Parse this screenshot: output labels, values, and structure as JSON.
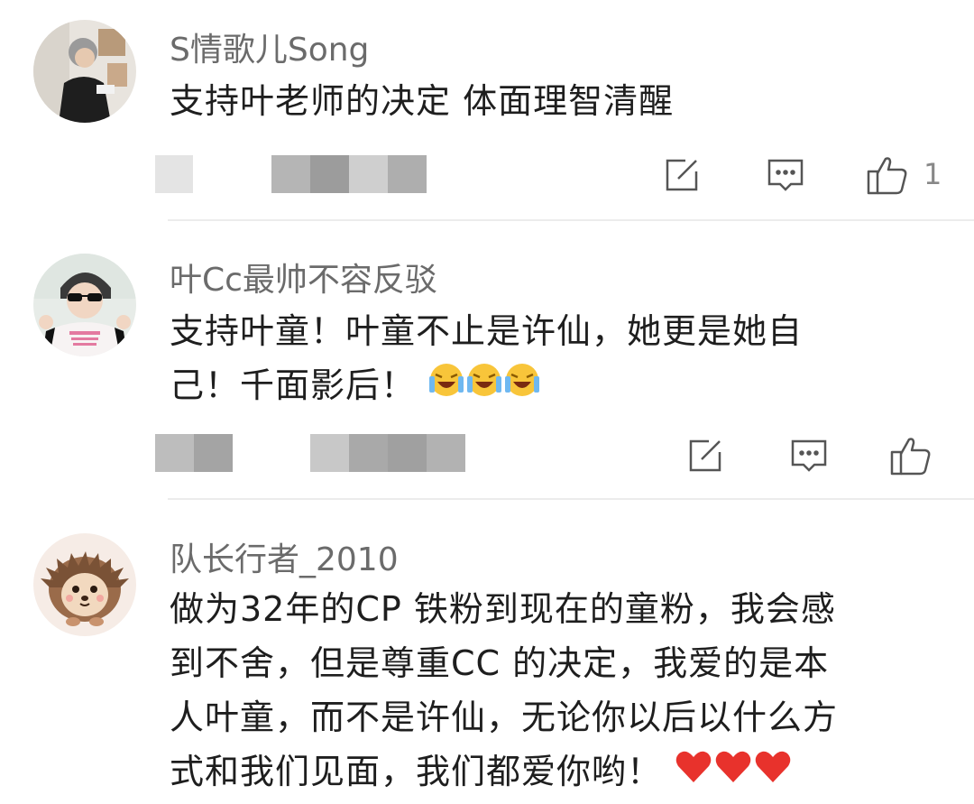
{
  "comments": [
    {
      "username": "S情歌儿Song",
      "text": "支持叶老师的决定 体面理智清醒",
      "likes": "1",
      "avatar_icon": "person-photo-avatar"
    },
    {
      "username": "叶Cc最帅不容反驳",
      "text_line1": "支持叶童！叶童不止是许仙，她更是她自",
      "text_line2": "己！千面影后！",
      "emoji_icon": "laughing-crying-emoji",
      "likes": "",
      "avatar_icon": "person-sunglasses-avatar"
    },
    {
      "username": "队长行者_2010",
      "text_lines": [
        "做为32年的CP 铁粉到现在的童粉，我会感",
        "到不舍，但是尊重CC 的决定，我爱的是本",
        "人叶童，而不是许仙，无论你以后以什么方",
        "式和我们见面，我们都爱你哟！"
      ],
      "emoji_icon": "red-heart-emoji",
      "avatar_icon": "hedgehog-avatar"
    }
  ],
  "actions": {
    "repost_icon": "repost-icon",
    "comment_icon": "comment-icon",
    "like_icon": "thumbs-up-icon"
  }
}
